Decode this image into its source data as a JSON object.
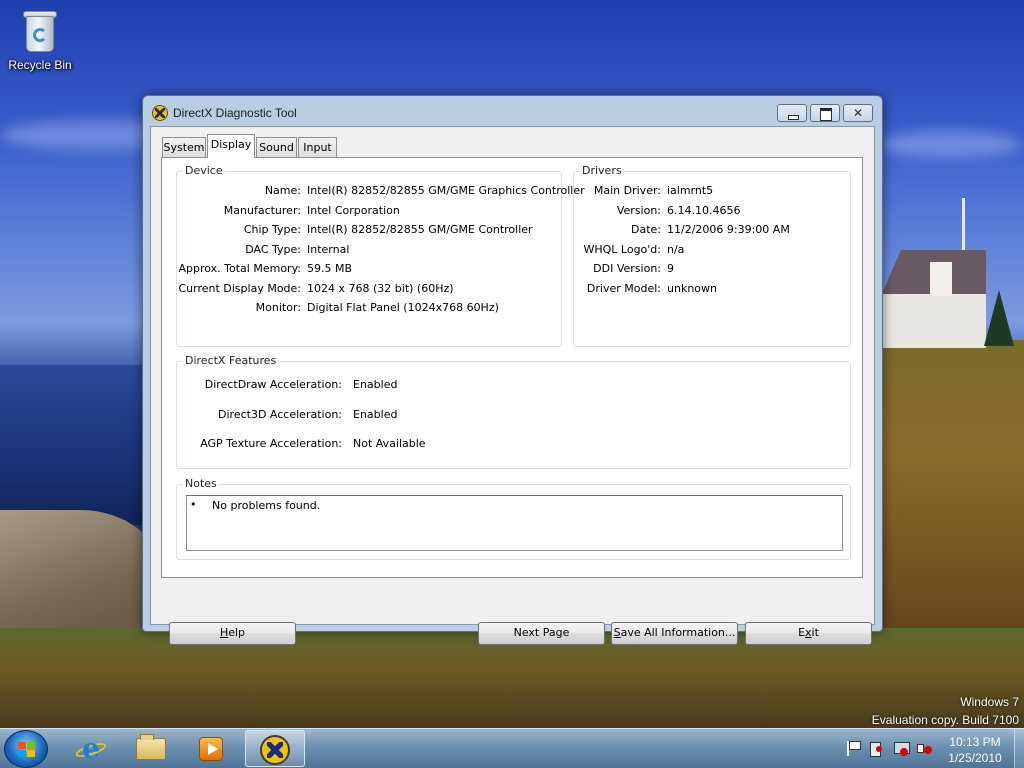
{
  "desktop": {
    "recycle_bin_label": "Recycle Bin",
    "watermark_line1": "Windows 7",
    "watermark_line2": "Evaluation copy. Build 7100"
  },
  "window": {
    "title": "DirectX Diagnostic Tool",
    "icon": "directx-icon",
    "controls": {
      "minimize": "minimize-icon",
      "maximize": "maximize-icon",
      "close": "close-icon"
    }
  },
  "tabs": [
    {
      "label": "System",
      "active": false
    },
    {
      "label": "Display",
      "active": true
    },
    {
      "label": "Sound",
      "active": false
    },
    {
      "label": "Input",
      "active": false
    }
  ],
  "device": {
    "title": "Device",
    "rows": [
      {
        "label": "Name:",
        "value": "Intel(R) 82852/82855 GM/GME Graphics Controller"
      },
      {
        "label": "Manufacturer:",
        "value": "Intel Corporation"
      },
      {
        "label": "Chip Type:",
        "value": "Intel(R) 82852/82855 GM/GME Controller"
      },
      {
        "label": "DAC Type:",
        "value": "Internal"
      },
      {
        "label": "Approx. Total Memory:",
        "value": "59.5 MB"
      },
      {
        "label": "Current Display Mode:",
        "value": "1024 x 768 (32 bit) (60Hz)"
      },
      {
        "label": "Monitor:",
        "value": "Digital Flat Panel (1024x768 60Hz)"
      }
    ]
  },
  "drivers": {
    "title": "Drivers",
    "rows": [
      {
        "label": "Main Driver:",
        "value": "ialmrnt5"
      },
      {
        "label": "Version:",
        "value": "6.14.10.4656"
      },
      {
        "label": "Date:",
        "value": "11/2/2006 9:39:00 AM"
      },
      {
        "label": "WHQL Logo'd:",
        "value": "n/a"
      },
      {
        "label": "DDI Version:",
        "value": "9"
      },
      {
        "label": "Driver Model:",
        "value": "unknown"
      }
    ]
  },
  "features": {
    "title": "DirectX Features",
    "rows": [
      {
        "label": "DirectDraw Acceleration:",
        "value": "Enabled"
      },
      {
        "label": "Direct3D Acceleration:",
        "value": "Enabled"
      },
      {
        "label": "AGP Texture Acceleration:",
        "value": "Not Available"
      }
    ]
  },
  "notes": {
    "title": "Notes",
    "bullet": "•",
    "items": [
      "No problems found."
    ]
  },
  "buttons": {
    "help_accel": "H",
    "help_rest": "elp",
    "next_page": "Next Page",
    "save_accel": "S",
    "save_rest": "ave All Information...",
    "exit_pre": "E",
    "exit_accel": "x",
    "exit_rest": "it"
  },
  "taskbar": {
    "time": "10:13 PM",
    "date": "1/25/2010",
    "pinned": [
      "internet-explorer-icon",
      "windows-explorer-icon",
      "media-player-icon",
      "directx-icon"
    ],
    "tray": [
      "action-center-flag-icon",
      "power-icon",
      "network-icon",
      "volume-muted-icon"
    ]
  }
}
